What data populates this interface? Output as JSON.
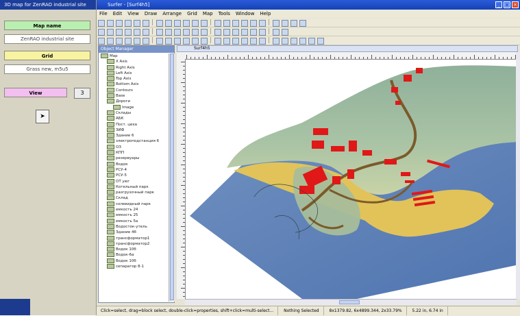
{
  "left_panel": {
    "title": "3D map for ZenRAO industrial site",
    "map_name_label": "Map name",
    "map_name_value": "ZenRAO industrial site",
    "grid_label": "Grid",
    "grid_value": "Grass new, m5u5",
    "view_label": "View",
    "view_button": "3",
    "colors": {
      "map_name": "#b9efb0",
      "grid": "#f7f3a0",
      "view": "#f2bff0"
    }
  },
  "app": {
    "title": "Surfer - [Surf4h5]",
    "menu": [
      "File",
      "Edit",
      "View",
      "Draw",
      "Arrange",
      "Grid",
      "Map",
      "Tools",
      "Window",
      "Help"
    ],
    "doc_tab": "Surf4h5"
  },
  "layers": {
    "header": "Object Manager",
    "items": [
      {
        "label": "Map",
        "level": 0
      },
      {
        "label": "X Axis",
        "level": 1
      },
      {
        "label": "Right Axis",
        "level": 1
      },
      {
        "label": "Left Axis",
        "level": 1
      },
      {
        "label": "Top Axis",
        "level": 1
      },
      {
        "label": "Bottom Axis",
        "level": 1
      },
      {
        "label": "Contours",
        "level": 1
      },
      {
        "label": "Base",
        "level": 1
      },
      {
        "label": "Дороги",
        "level": 1
      },
      {
        "label": "Image",
        "level": 2
      },
      {
        "label": "Склады",
        "level": 1
      },
      {
        "label": "АБК",
        "level": 1
      },
      {
        "label": "Пост. цеха",
        "level": 1
      },
      {
        "label": "ЗИФ",
        "level": 1
      },
      {
        "label": "Здание 6",
        "level": 1
      },
      {
        "label": "электроподстанция 6",
        "level": 1
      },
      {
        "label": "ОЗ",
        "level": 1
      },
      {
        "label": "КПП",
        "level": 1
      },
      {
        "label": "резервуары",
        "level": 1
      },
      {
        "label": "Водок",
        "level": 1
      },
      {
        "label": "РСУ-4",
        "level": 1
      },
      {
        "label": "РСУ-5",
        "level": 1
      },
      {
        "label": "ОТ уюг",
        "level": 1
      },
      {
        "label": "Котельный парк",
        "level": 1
      },
      {
        "label": "разгрузочный парк",
        "level": 1
      },
      {
        "label": "Склад",
        "level": 1
      },
      {
        "label": "солевидный парк",
        "level": 1
      },
      {
        "label": "емкость 24",
        "level": 1
      },
      {
        "label": "емкость 25",
        "level": 1
      },
      {
        "label": "емкость 5а",
        "level": 1
      },
      {
        "label": "Водосток-утель",
        "level": 1
      },
      {
        "label": "Здание 4б",
        "level": 1
      },
      {
        "label": "трансформатор1",
        "level": 1
      },
      {
        "label": "трансформатор2",
        "level": 1
      },
      {
        "label": "Водок 10б",
        "level": 1
      },
      {
        "label": "Водок-6а",
        "level": 1
      },
      {
        "label": "Водок 10б",
        "level": 1
      },
      {
        "label": "сепаратор 8-1",
        "level": 1
      }
    ]
  },
  "status": {
    "hint": "Click=select, drag=block select, double-click=properties, shift+click=multi-select...",
    "selection": "Nothing Selected",
    "coords": "8x1379.82, 6x4899.344, 2x33.79%",
    "size": "5.22 in, 6.74 in"
  }
}
